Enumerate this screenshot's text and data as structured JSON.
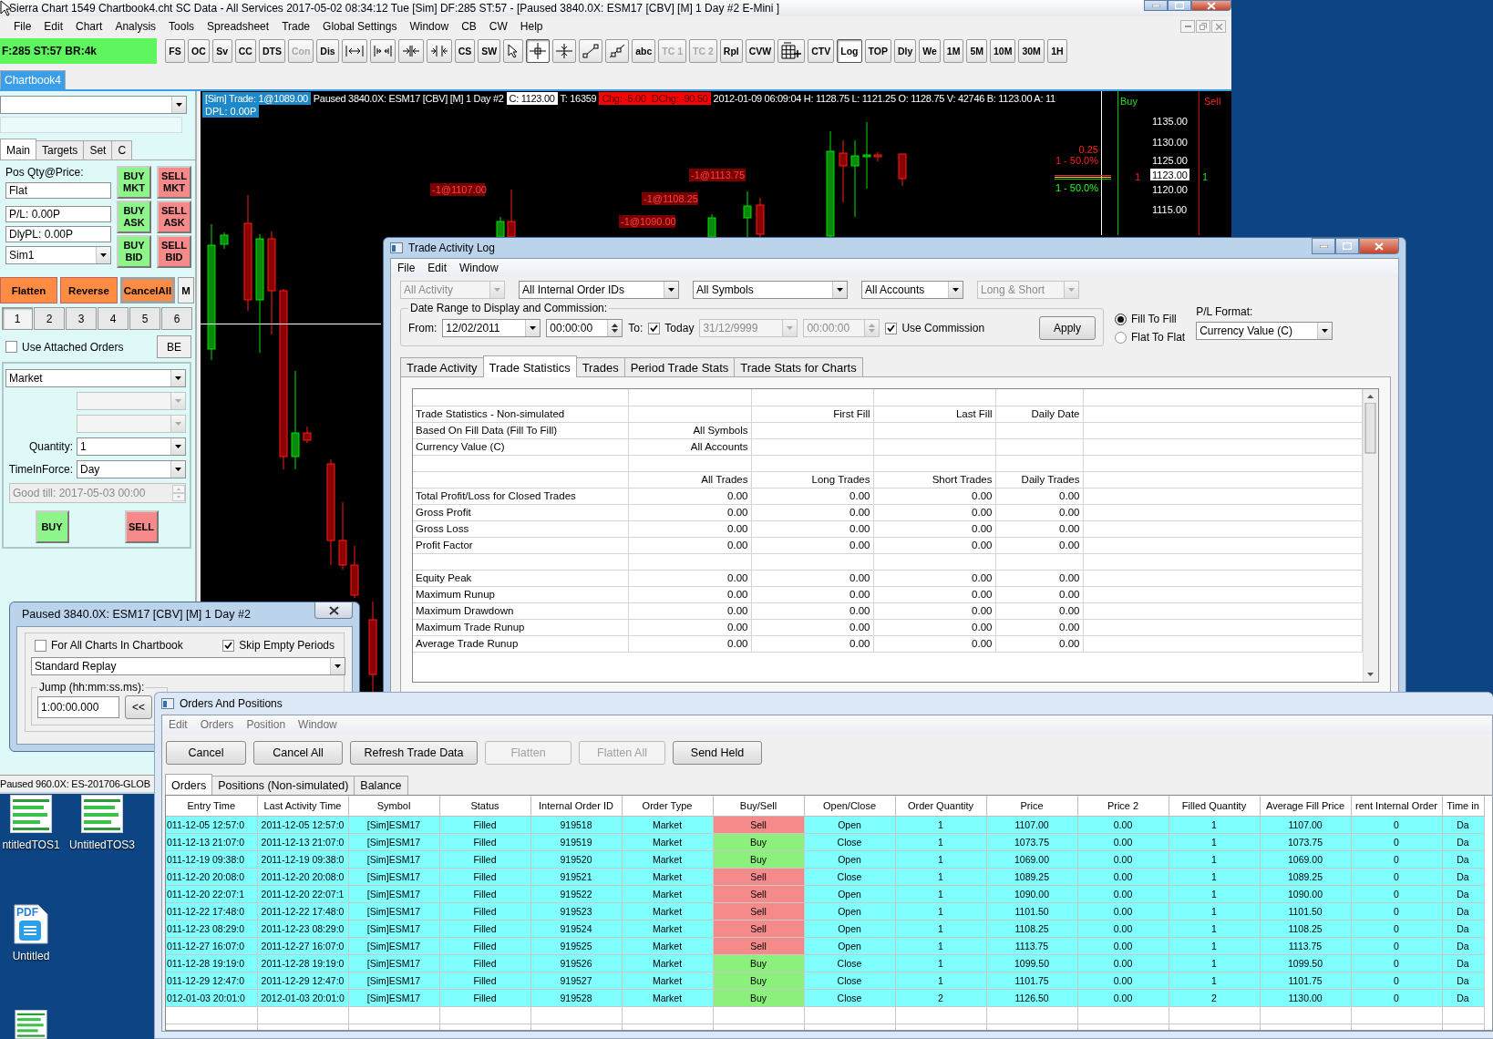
{
  "main_window": {
    "title": "Sierra Chart 1549 Chartbook4.cht SC Data - All Services 2017-05-02 08:34:12 Tue [Sim] DF:285 ST:57 - [Paused 3840.0X: ESM17 [CBV] [M] 1 Day #2 E-Mini ]",
    "menu": [
      "File",
      "Edit",
      "Chart",
      "Analysis",
      "Tools",
      "Spreadsheet",
      "Trade",
      "Global Settings",
      "Window",
      "CB",
      "CW",
      "Help"
    ],
    "status_box": "F:285 ST:57 BR:4k",
    "toolbar": [
      {
        "kind": "text",
        "label": "FS",
        "pressed": false,
        "disabled": false
      },
      {
        "kind": "text",
        "label": "OC",
        "pressed": false,
        "disabled": false
      },
      {
        "kind": "text",
        "label": "Sv",
        "pressed": false,
        "disabled": false
      },
      {
        "kind": "text",
        "label": "CC",
        "pressed": false,
        "disabled": false
      },
      {
        "kind": "text",
        "label": "DTS",
        "pressed": false,
        "disabled": false
      },
      {
        "kind": "text",
        "label": "Con",
        "pressed": false,
        "disabled": true
      },
      {
        "kind": "text",
        "label": "Dis",
        "pressed": false,
        "disabled": false
      },
      {
        "kind": "spacing-out",
        "pressed": false,
        "disabled": false
      },
      {
        "kind": "spacing-in",
        "pressed": false,
        "disabled": false
      },
      {
        "kind": "spacing-left",
        "pressed": false,
        "disabled": false
      },
      {
        "kind": "spacing-right",
        "pressed": false,
        "disabled": false
      },
      {
        "kind": "text",
        "label": "CS",
        "pressed": false,
        "disabled": false
      },
      {
        "kind": "text",
        "label": "SW",
        "pressed": false,
        "disabled": false
      },
      {
        "kind": "pointer",
        "pressed": false,
        "disabled": false
      },
      {
        "kind": "crosshair",
        "pressed": true,
        "disabled": false
      },
      {
        "kind": "values-cursor",
        "pressed": false,
        "disabled": false
      },
      {
        "kind": "line",
        "pressed": false,
        "disabled": false
      },
      {
        "kind": "ray",
        "pressed": false,
        "disabled": false
      },
      {
        "kind": "text",
        "label": "abc",
        "pressed": false,
        "disabled": false
      },
      {
        "kind": "text",
        "label": "TC 1",
        "pressed": false,
        "disabled": true
      },
      {
        "kind": "text",
        "label": "TC 2",
        "pressed": false,
        "disabled": true
      },
      {
        "kind": "text",
        "label": "Rpl",
        "pressed": false,
        "disabled": false
      },
      {
        "kind": "text",
        "label": "CVW",
        "pressed": false,
        "disabled": false
      },
      {
        "kind": "grid",
        "pressed": false,
        "disabled": false
      },
      {
        "kind": "text",
        "label": "CTV",
        "pressed": false,
        "disabled": false
      },
      {
        "kind": "text",
        "label": "Log",
        "pressed": true,
        "disabled": false
      },
      {
        "kind": "text",
        "label": "TOP",
        "pressed": false,
        "disabled": false
      },
      {
        "kind": "text",
        "label": "Dly",
        "pressed": false,
        "disabled": false
      },
      {
        "kind": "text",
        "label": "We",
        "pressed": false,
        "disabled": false
      },
      {
        "kind": "text",
        "label": "1M",
        "pressed": false,
        "disabled": false
      },
      {
        "kind": "text",
        "label": "5M",
        "pressed": false,
        "disabled": false
      },
      {
        "kind": "text",
        "label": "10M",
        "pressed": false,
        "disabled": false
      },
      {
        "kind": "text",
        "label": "30M",
        "pressed": false,
        "disabled": false
      },
      {
        "kind": "text",
        "label": "1H",
        "pressed": false,
        "disabled": false
      }
    ],
    "chartbook_tabs": [
      {
        "label": "Chartbook4",
        "selected": true
      }
    ]
  },
  "trade_panel": {
    "tabs": [
      {
        "label": "Main",
        "selected": true
      },
      {
        "label": "Targets",
        "selected": false
      },
      {
        "label": "Set",
        "selected": false
      },
      {
        "label": "C",
        "selected": false
      }
    ],
    "position_label": "Pos Qty@Price:",
    "fields": [
      "Flat",
      "P/L: 0.00P",
      "DlyPL: 0.00P"
    ],
    "account": "Sim1",
    "order_buttons": [
      {
        "label": "BUY MKT",
        "kind": "buy"
      },
      {
        "label": "SELL MKT",
        "kind": "sell"
      },
      {
        "label": "BUY ASK",
        "kind": "buy"
      },
      {
        "label": "SELL ASK",
        "kind": "sell"
      },
      {
        "label": "BUY BID",
        "kind": "buy"
      },
      {
        "label": "SELL BID",
        "kind": "sell"
      }
    ],
    "action_buttons": [
      {
        "label": "Flatten",
        "kind": "orange"
      },
      {
        "label": "Reverse",
        "kind": "orange"
      },
      {
        "label": "CancelAll",
        "kind": "cancel"
      },
      {
        "label": "M",
        "kind": "plain"
      }
    ],
    "qty_presets": [
      {
        "label": "1",
        "selected": true
      },
      {
        "label": "2",
        "selected": false
      },
      {
        "label": "3",
        "selected": false
      },
      {
        "label": "4",
        "selected": false
      },
      {
        "label": "5",
        "selected": false
      },
      {
        "label": "6",
        "selected": false
      }
    ],
    "use_attached_orders": {
      "label": "Use Attached Orders",
      "checked": false
    },
    "be_button": "BE",
    "order_type": "Market",
    "quantity_label": "Quantity:",
    "quantity": "1",
    "tif_label": "TimeInForce:",
    "tif": "Day",
    "good_till": "Good till: 2017-05-03 00:00",
    "buy_button": "BUY",
    "sell_button": "SELL"
  },
  "chart": {
    "header": [
      {
        "kind": "trade",
        "text": "[Sim] Trade: 1@1089.00"
      },
      {
        "kind": "plain",
        "text": "Paused 3840.0X: ESM17 [CBV] [M] 1 Day #2"
      },
      {
        "kind": "close",
        "text": "C: 1123.00"
      },
      {
        "kind": "plain",
        "text": "T: 16359"
      },
      {
        "kind": "change",
        "text": "Chg: -5.00"
      },
      {
        "kind": "change",
        "text": "DChg: -90.50"
      },
      {
        "kind": "plain",
        "text": "2012-01-09 06:09:04 H: 1128.75 L: 1121.25 O: 1128.75 V: 42746 B: 1123.00 A: 11"
      }
    ],
    "dpl": "DPL: 0.00P",
    "buy_label": "Buy",
    "sell_label": "Sell",
    "price_labels": [
      "1135.00",
      "1130.00",
      "1125.00",
      "1120.00",
      "1115.00"
    ],
    "current_price": "1123.00",
    "order_labels": [
      "-1@1107.00",
      "-1@1113.75",
      "-1@1108.25",
      "-1@1090.00"
    ],
    "target_labels": [
      {
        "text": "0.25",
        "kind": "sell"
      },
      {
        "text": "1 - 50.0%",
        "kind": "sell"
      },
      {
        "text": "1 - 50.0%",
        "kind": "buy"
      }
    ],
    "sell_quantity": "1",
    "buy_quantity": "1"
  },
  "replay_dialog": {
    "title": "Paused 3840.0X: ESM17 [CBV] [M] 1 Day #2",
    "options": [
      {
        "label": "For All Charts In Chartbook",
        "checked": false
      },
      {
        "label": "Skip Empty Periods",
        "checked": true
      }
    ],
    "mode": "Standard Replay",
    "jump_label": "Jump (hh:mm:ss.ms):",
    "jump_value": "1:00:00.000",
    "back_button": "<<"
  },
  "chart_status_bar": "Paused 960.0X: ES-201706-GLOB",
  "trade_activity_log": {
    "title": "Trade Activity Log",
    "menu": [
      "File",
      "Edit",
      "Window"
    ],
    "filters": [
      {
        "value": "All Activity",
        "disabled": true
      },
      {
        "value": "All Internal Order IDs",
        "disabled": false
      },
      {
        "value": "All Symbols",
        "disabled": false
      },
      {
        "value": "All Accounts",
        "disabled": false
      },
      {
        "value": "Long & Short",
        "disabled": true
      }
    ],
    "date_group_label": "Date Range to Display and Commission:",
    "from_label": "From:",
    "from_date": "12/02/2011",
    "from_time": "00:00:00",
    "to_label": "To:",
    "today": {
      "label": "Today",
      "checked": true
    },
    "to_date": "31/12/9999",
    "to_time": "00:00:00",
    "use_commission": {
      "label": "Use Commission",
      "checked": true
    },
    "apply_button": "Apply",
    "fill_modes": [
      {
        "label": "Fill To Fill",
        "selected": true
      },
      {
        "label": "Flat To Flat",
        "selected": false
      }
    ],
    "pl_format_label": "P/L Format:",
    "pl_format": "Currency Value (C)",
    "tabs": [
      {
        "label": "Trade Activity",
        "selected": false
      },
      {
        "label": "Trade Statistics",
        "selected": true
      },
      {
        "label": "Trades",
        "selected": false
      },
      {
        "label": "Period Trade Stats",
        "selected": false
      },
      {
        "label": "Trade Stats for Charts",
        "selected": false
      }
    ],
    "statistics": [
      {
        "kind": "blank"
      },
      {
        "kind": "row",
        "label": "Trade Statistics - Non-simulated",
        "column_3": "First Fill",
        "column_4": "Last Fill",
        "column_5": "Daily Date"
      },
      {
        "kind": "row",
        "label": "Based On Fill Data (Fill To Fill)",
        "column_2": "All Symbols"
      },
      {
        "kind": "row",
        "label": "Currency Value (C)",
        "column_2": "All Accounts"
      },
      {
        "kind": "blank"
      },
      {
        "kind": "row",
        "column_2": "All Trades",
        "column_3": "Long Trades",
        "column_4": "Short Trades",
        "column_5": "Daily Trades"
      },
      {
        "kind": "row",
        "label": "Total Profit/Loss for Closed Trades",
        "column_2": "0.00",
        "column_3": "0.00",
        "column_4": "0.00",
        "column_5": "0.00"
      },
      {
        "kind": "row",
        "label": "Gross Profit",
        "column_2": "0.00",
        "column_3": "0.00",
        "column_4": "0.00",
        "column_5": "0.00"
      },
      {
        "kind": "row",
        "label": "Gross Loss",
        "column_2": "0.00",
        "column_3": "0.00",
        "column_4": "0.00",
        "column_5": "0.00"
      },
      {
        "kind": "row",
        "label": "Profit Factor",
        "column_2": "0.00",
        "column_3": "0.00",
        "column_4": "0.00",
        "column_5": "0.00"
      },
      {
        "kind": "blank"
      },
      {
        "kind": "row",
        "label": "Equity Peak",
        "column_2": "0.00",
        "column_3": "0.00",
        "column_4": "0.00",
        "column_5": "0.00"
      },
      {
        "kind": "row",
        "label": "Maximum Runup",
        "column_2": "0.00",
        "column_3": "0.00",
        "column_4": "0.00",
        "column_5": "0.00"
      },
      {
        "kind": "row",
        "label": "Maximum Drawdown",
        "column_2": "0.00",
        "column_3": "0.00",
        "column_4": "0.00",
        "column_5": "0.00"
      },
      {
        "kind": "row",
        "label": "Maximum Trade Runup",
        "column_2": "0.00",
        "column_3": "0.00",
        "column_4": "0.00",
        "column_5": "0.00"
      },
      {
        "kind": "row",
        "label": "Average Trade Runup",
        "column_2": "0.00",
        "column_3": "0.00",
        "column_4": "0.00",
        "column_5": "0.00"
      }
    ]
  },
  "orders_and_positions": {
    "title": "Orders And Positions",
    "menu": [
      "Edit",
      "Orders",
      "Position",
      "Window"
    ],
    "buttons": [
      {
        "label": "Cancel",
        "disabled": false
      },
      {
        "label": "Cancel All",
        "disabled": false
      },
      {
        "label": "Refresh Trade Data",
        "disabled": false
      },
      {
        "label": "Flatten",
        "disabled": true
      },
      {
        "label": "Flatten All",
        "disabled": true
      },
      {
        "label": "Send Held",
        "disabled": false
      }
    ],
    "tabs": [
      {
        "label": "Orders",
        "selected": true
      },
      {
        "label": "Positions (Non-simulated)",
        "selected": false
      },
      {
        "label": "Balance",
        "selected": false
      }
    ],
    "columns": [
      "Entry Time",
      "Last Activity Time",
      "Symbol",
      "Status",
      "Internal Order ID",
      "Order Type",
      "Buy/Sell",
      "Open/Close",
      "Order Quantity",
      "Price",
      "Price 2",
      "Filled Quantity",
      "Average Fill Price",
      "rent Internal Order",
      "Time in"
    ],
    "rows": [
      {
        "cells": [
          "011-12-05 12:57:0",
          "2011-12-05 12:57:0",
          "[Sim]ESM17",
          "Filled",
          "919518",
          "Market",
          "Sell",
          "Open",
          "1",
          "1107.00",
          "0.00",
          "1",
          "1107.00",
          "0",
          "Da"
        ],
        "color": "#f48a8a"
      },
      {
        "cells": [
          "011-12-13 21:07:0",
          "2011-12-13 21:07:0",
          "[Sim]ESM17",
          "Filled",
          "919519",
          "Market",
          "Buy",
          "Close",
          "1",
          "1073.75",
          "0.00",
          "1",
          "1073.75",
          "0",
          "Da"
        ],
        "color": "#8cf07c"
      },
      {
        "cells": [
          "011-12-19 09:38:0",
          "2011-12-19 09:38:0",
          "[Sim]ESM17",
          "Filled",
          "919520",
          "Market",
          "Buy",
          "Open",
          "1",
          "1069.00",
          "0.00",
          "1",
          "1069.00",
          "0",
          "Da"
        ],
        "color": "#8cf07c"
      },
      {
        "cells": [
          "011-12-20 20:08:0",
          "2011-12-20 20:08:0",
          "[Sim]ESM17",
          "Filled",
          "919521",
          "Market",
          "Sell",
          "Close",
          "1",
          "1089.25",
          "0.00",
          "1",
          "1089.25",
          "0",
          "Da"
        ],
        "color": "#f48a8a"
      },
      {
        "cells": [
          "011-12-20 22:07:1",
          "2011-12-20 22:07:1",
          "[Sim]ESM17",
          "Filled",
          "919522",
          "Market",
          "Sell",
          "Open",
          "1",
          "1090.00",
          "0.00",
          "1",
          "1090.00",
          "0",
          "Da"
        ],
        "color": "#f48a8a"
      },
      {
        "cells": [
          "011-12-22 17:48:0",
          "2011-12-22 17:48:0",
          "[Sim]ESM17",
          "Filled",
          "919523",
          "Market",
          "Sell",
          "Open",
          "1",
          "1101.50",
          "0.00",
          "1",
          "1101.50",
          "0",
          "Da"
        ],
        "color": "#f48a8a"
      },
      {
        "cells": [
          "011-12-23 08:29:0",
          "2011-12-23 08:29:0",
          "[Sim]ESM17",
          "Filled",
          "919524",
          "Market",
          "Sell",
          "Open",
          "1",
          "1108.25",
          "0.00",
          "1",
          "1108.25",
          "0",
          "Da"
        ],
        "color": "#f48a8a"
      },
      {
        "cells": [
          "011-12-27 16:07:0",
          "2011-12-27 16:07:0",
          "[Sim]ESM17",
          "Filled",
          "919525",
          "Market",
          "Sell",
          "Open",
          "1",
          "1113.75",
          "0.00",
          "1",
          "1113.75",
          "0",
          "Da"
        ],
        "color": "#f48a8a"
      },
      {
        "cells": [
          "011-12-28 19:19:0",
          "2011-12-28 19:19:0",
          "[Sim]ESM17",
          "Filled",
          "919526",
          "Market",
          "Buy",
          "Close",
          "1",
          "1099.50",
          "0.00",
          "1",
          "1099.50",
          "0",
          "Da"
        ],
        "color": "#8cf07c"
      },
      {
        "cells": [
          "011-12-29 12:47:0",
          "2011-12-29 12:47:0",
          "[Sim]ESM17",
          "Filled",
          "919527",
          "Market",
          "Buy",
          "Close",
          "1",
          "1101.75",
          "0.00",
          "1",
          "1101.75",
          "0",
          "Da"
        ],
        "color": "#8cf07c"
      },
      {
        "cells": [
          "012-01-03 20:01:0",
          "2012-01-03 20:01:0",
          "[Sim]ESM17",
          "Filled",
          "919528",
          "Market",
          "Buy",
          "Close",
          "2",
          "1126.50",
          "0.00",
          "2",
          "1130.00",
          "0",
          "Da"
        ],
        "color": "#8cf07c"
      }
    ]
  },
  "desktop_icons": [
    {
      "kind": "document",
      "label": "ntitledTOS1"
    },
    {
      "kind": "document",
      "label": "UntitledTOS3"
    },
    {
      "kind": "pdf",
      "badge": "PDF",
      "label": "Untitled"
    },
    {
      "kind": "document"
    }
  ]
}
